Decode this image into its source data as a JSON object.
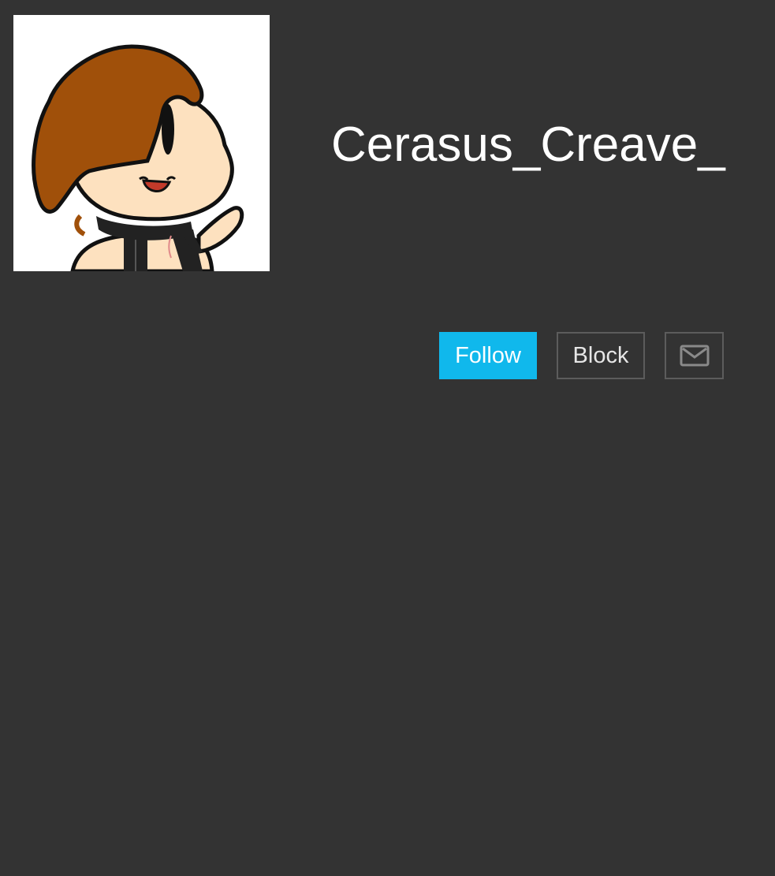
{
  "profile": {
    "username": "Cerasus_Creave_",
    "avatar_icon": "cartoon-character-avatar"
  },
  "actions": {
    "follow_label": "Follow",
    "block_label": "Block",
    "message_icon": "envelope-icon"
  },
  "colors": {
    "background": "#333333",
    "follow_button": "#10b8ec",
    "button_border": "#5c5c5c",
    "text": "#ffffff"
  }
}
